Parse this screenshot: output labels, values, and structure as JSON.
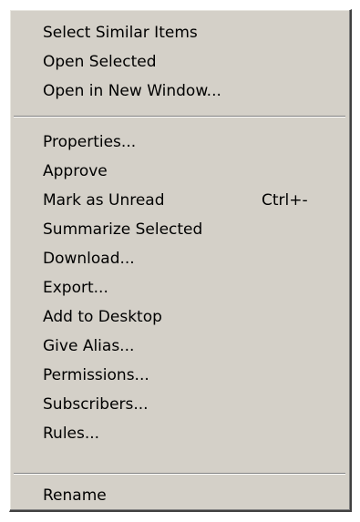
{
  "context_menu": {
    "group1": [
      {
        "label": "Select Similar Items"
      },
      {
        "label": "Open Selected"
      },
      {
        "label": "Open in New Window..."
      }
    ],
    "group2": [
      {
        "label": "Properties..."
      },
      {
        "label": "Approve"
      },
      {
        "label": "Mark as Unread",
        "shortcut": "Ctrl+-"
      },
      {
        "label": "Summarize Selected"
      },
      {
        "label": "Download..."
      },
      {
        "label": "Export..."
      },
      {
        "label": "Add to Desktop"
      },
      {
        "label": "Give Alias..."
      },
      {
        "label": "Permissions..."
      },
      {
        "label": "Subscribers..."
      },
      {
        "label": "Rules..."
      }
    ],
    "group3": [
      {
        "label": "Rename"
      }
    ]
  },
  "colors": {
    "menu_background": "#d4d0c8",
    "text": "#000000",
    "separator_dark": "#808080",
    "separator_light": "#ffffff"
  }
}
